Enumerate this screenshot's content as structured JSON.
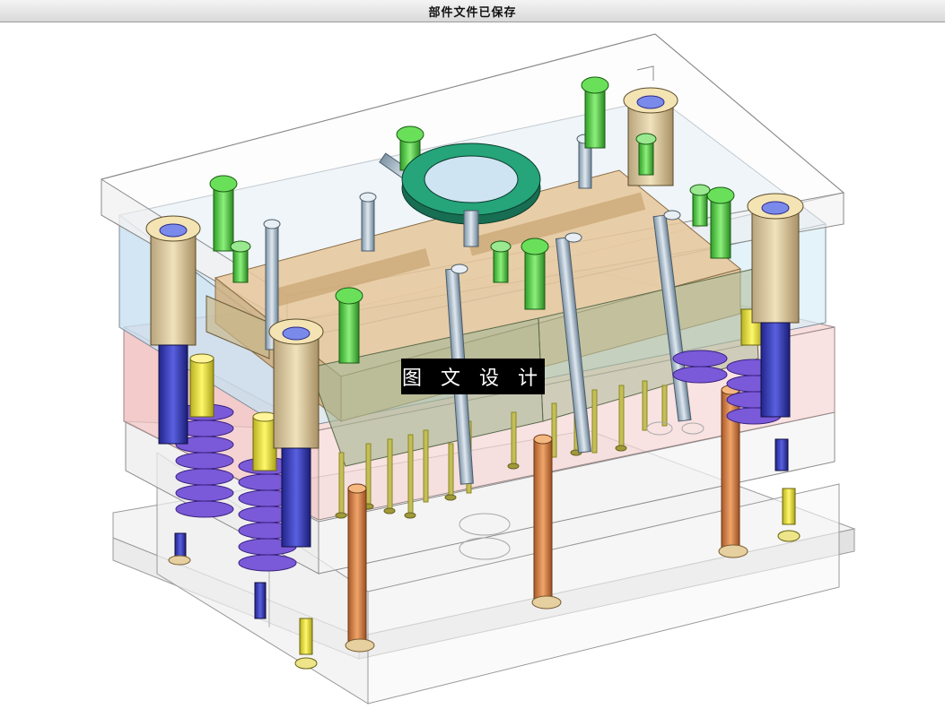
{
  "window": {
    "title": "部件文件已保存"
  },
  "viewport": {
    "content": "3d-model-view",
    "watermark_text": "图 文 设 计"
  },
  "colors": {
    "top_plate": "#cfe4f2",
    "a_plate": "#f2c7c7",
    "core_insert": "#d8b98a",
    "locating_ring": "#1e8f6a",
    "screw": "#4ccd3c",
    "spring": "#6a4fd0",
    "guide_pillar": "#3a3fb0",
    "ejector_pin": "#b8b04a",
    "return_pin": "#d08a4a",
    "bushing": "#e7d79a"
  },
  "icons": [
    "locating-ring-icon",
    "guide-bushing-icon",
    "screw-icon",
    "spring-icon",
    "ejector-pin-icon",
    "return-pin-icon"
  ]
}
